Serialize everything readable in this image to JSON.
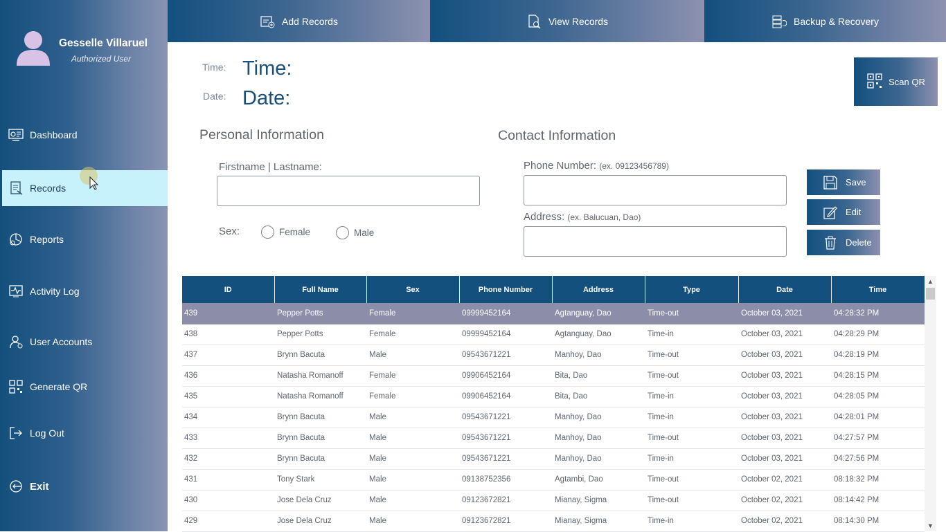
{
  "user": {
    "name": "Gesselle Villaruel",
    "role": "Authorized User"
  },
  "sidebar": {
    "items": [
      {
        "label": "Dashboard",
        "icon": "dashboard-icon"
      },
      {
        "label": "Records",
        "icon": "records-icon",
        "active": true
      },
      {
        "label": "Reports",
        "icon": "reports-icon"
      },
      {
        "label": "Activity Log",
        "icon": "activity-log-icon"
      },
      {
        "label": "User Accounts",
        "icon": "user-accounts-icon"
      },
      {
        "label": "Generate QR",
        "icon": "qr-code-icon"
      },
      {
        "label": "Log Out",
        "icon": "logout-icon"
      },
      {
        "label": "Exit",
        "icon": "exit-icon"
      }
    ]
  },
  "tabs": [
    {
      "label": "Add Records",
      "icon": "add-records-icon"
    },
    {
      "label": "View Records",
      "icon": "view-records-icon"
    },
    {
      "label": "Backup & Recovery",
      "icon": "backup-icon"
    }
  ],
  "clock": {
    "time_label": "Time:",
    "time_value": "Time:",
    "date_label": "Date:",
    "date_value": "Date:"
  },
  "scan_qr": "Scan QR",
  "personal": {
    "title": "Personal Information",
    "name_label": "Firstname | Lastname:",
    "name_value": "",
    "sex_label": "Sex:",
    "female": "Female",
    "male": "Male"
  },
  "contact": {
    "title": "Contact Information",
    "phone_label": "Phone Number:",
    "phone_hint": "(ex. 09123456789)",
    "phone_value": "",
    "address_label": "Address:",
    "address_hint": "(ex. Balucuan, Dao)",
    "address_value": ""
  },
  "actions": {
    "save": "Save",
    "edit": "Edit",
    "delete": "Delete"
  },
  "table": {
    "columns": [
      "ID",
      "Full Name",
      "Sex",
      "Phone Number",
      "Address",
      "Type",
      "Date",
      "Time"
    ],
    "rows": [
      [
        "439",
        "Pepper Potts",
        "Female",
        "09999452164",
        "Agtanguay, Dao",
        "Time-out",
        "October 03, 2021",
        "04:28:32 PM"
      ],
      [
        "438",
        "Pepper Potts",
        "Female",
        "09999452164",
        "Agtanguay, Dao",
        "Time-in",
        "October 03, 2021",
        "04:28:29 PM"
      ],
      [
        "437",
        "Brynn Bacuta",
        "Male",
        "09543671221",
        "Manhoy, Dao",
        "Time-out",
        "October 03, 2021",
        "04:28:19 PM"
      ],
      [
        "436",
        "Natasha Romanoff",
        "Female",
        "09906452164",
        "Bita, Dao",
        "Time-out",
        "October 03, 2021",
        "04:28:15 PM"
      ],
      [
        "435",
        "Natasha Romanoff",
        "Female",
        "09906452164",
        "Bita, Dao",
        "Time-in",
        "October 03, 2021",
        "04:28:05 PM"
      ],
      [
        "434",
        "Brynn Bacuta",
        "Male",
        "09543671221",
        "Manhoy, Dao",
        "Time-in",
        "October 03, 2021",
        "04:28:01 PM"
      ],
      [
        "433",
        "Brynn Bacuta",
        "Male",
        "09543671221",
        "Manhoy, Dao",
        "Time-out",
        "October 03, 2021",
        "04:27:57 PM"
      ],
      [
        "432",
        "Brynn Bacuta",
        "Male",
        "09543671221",
        "Manhoy, Dao",
        "Time-in",
        "October 03, 2021",
        "04:27:56 PM"
      ],
      [
        "431",
        "Tony Stark",
        "Male",
        "09138752356",
        "Agtambi, Dao",
        "Time-out",
        "October 02, 2021",
        "08:18:32 PM"
      ],
      [
        "430",
        "Jose Dela Cruz",
        "Male",
        "09123672821",
        "Mianay, Sigma",
        "Time-out",
        "October 02, 2021",
        "08:14:42 PM"
      ],
      [
        "429",
        "Jose Dela Cruz",
        "Male",
        "09123672821",
        "Mianay, Sigma",
        "Time-in",
        "October 02, 2021",
        "08:14:30 PM"
      ]
    ],
    "selected_row": 0
  },
  "colors": {
    "primary": "#13507e",
    "selected_row": "#8c8ea9",
    "active_nav": "#c7f1fb"
  }
}
